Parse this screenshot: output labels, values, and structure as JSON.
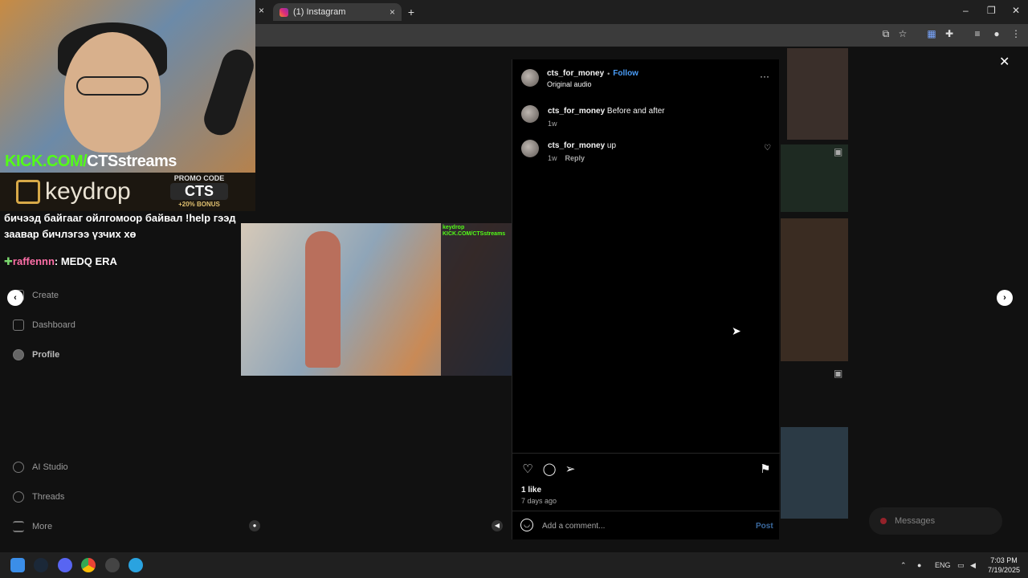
{
  "browser": {
    "tab_title": "(1) Instagram",
    "tab_close": "×",
    "new_tab": "+",
    "window_close": "×",
    "minimize": "–",
    "restore": "❐",
    "maximize_close": "✕"
  },
  "stream": {
    "kick_prefix": "KICK.COM/",
    "kick_channel": "CTSstreams",
    "brand": "keydrop",
    "promo_label": "PROMO CODE",
    "promo_code": "CTS",
    "promo_bonus": "+20% BONUS",
    "chat_text": "бичээд байгааг ойлгомоор байвал !help гээд заавар бичлэгээ үзчих хө",
    "chat_user": "raffennn",
    "chat_message": ": MEDQ ERA",
    "cam_kick": "KICK.COM/CTSstreams",
    "cam_brand": "keydrop"
  },
  "sidebar": {
    "items": [
      {
        "label": "Create"
      },
      {
        "label": "Dashboard"
      },
      {
        "label": "Profile"
      },
      {
        "label": "AI Studio"
      },
      {
        "label": "Threads"
      },
      {
        "label": "More"
      }
    ]
  },
  "post": {
    "username": "cts_for_money",
    "dot": "•",
    "follow": "Follow",
    "audio": "Original audio",
    "more": "···",
    "caption_user": "cts_for_money",
    "caption": "Before and after",
    "caption_time": "1w",
    "comments": [
      {
        "user": "cts_for_money",
        "text": "up",
        "time": "1w",
        "reply": "Reply"
      }
    ],
    "likes": "1 like",
    "date": "7 days ago",
    "comment_placeholder": "Add a comment...",
    "post_button": "Post"
  },
  "messages_pill": {
    "label": "Messages"
  },
  "taskbar": {
    "language": "ENG",
    "time": "7:03 PM",
    "date": "7/19/2025"
  }
}
